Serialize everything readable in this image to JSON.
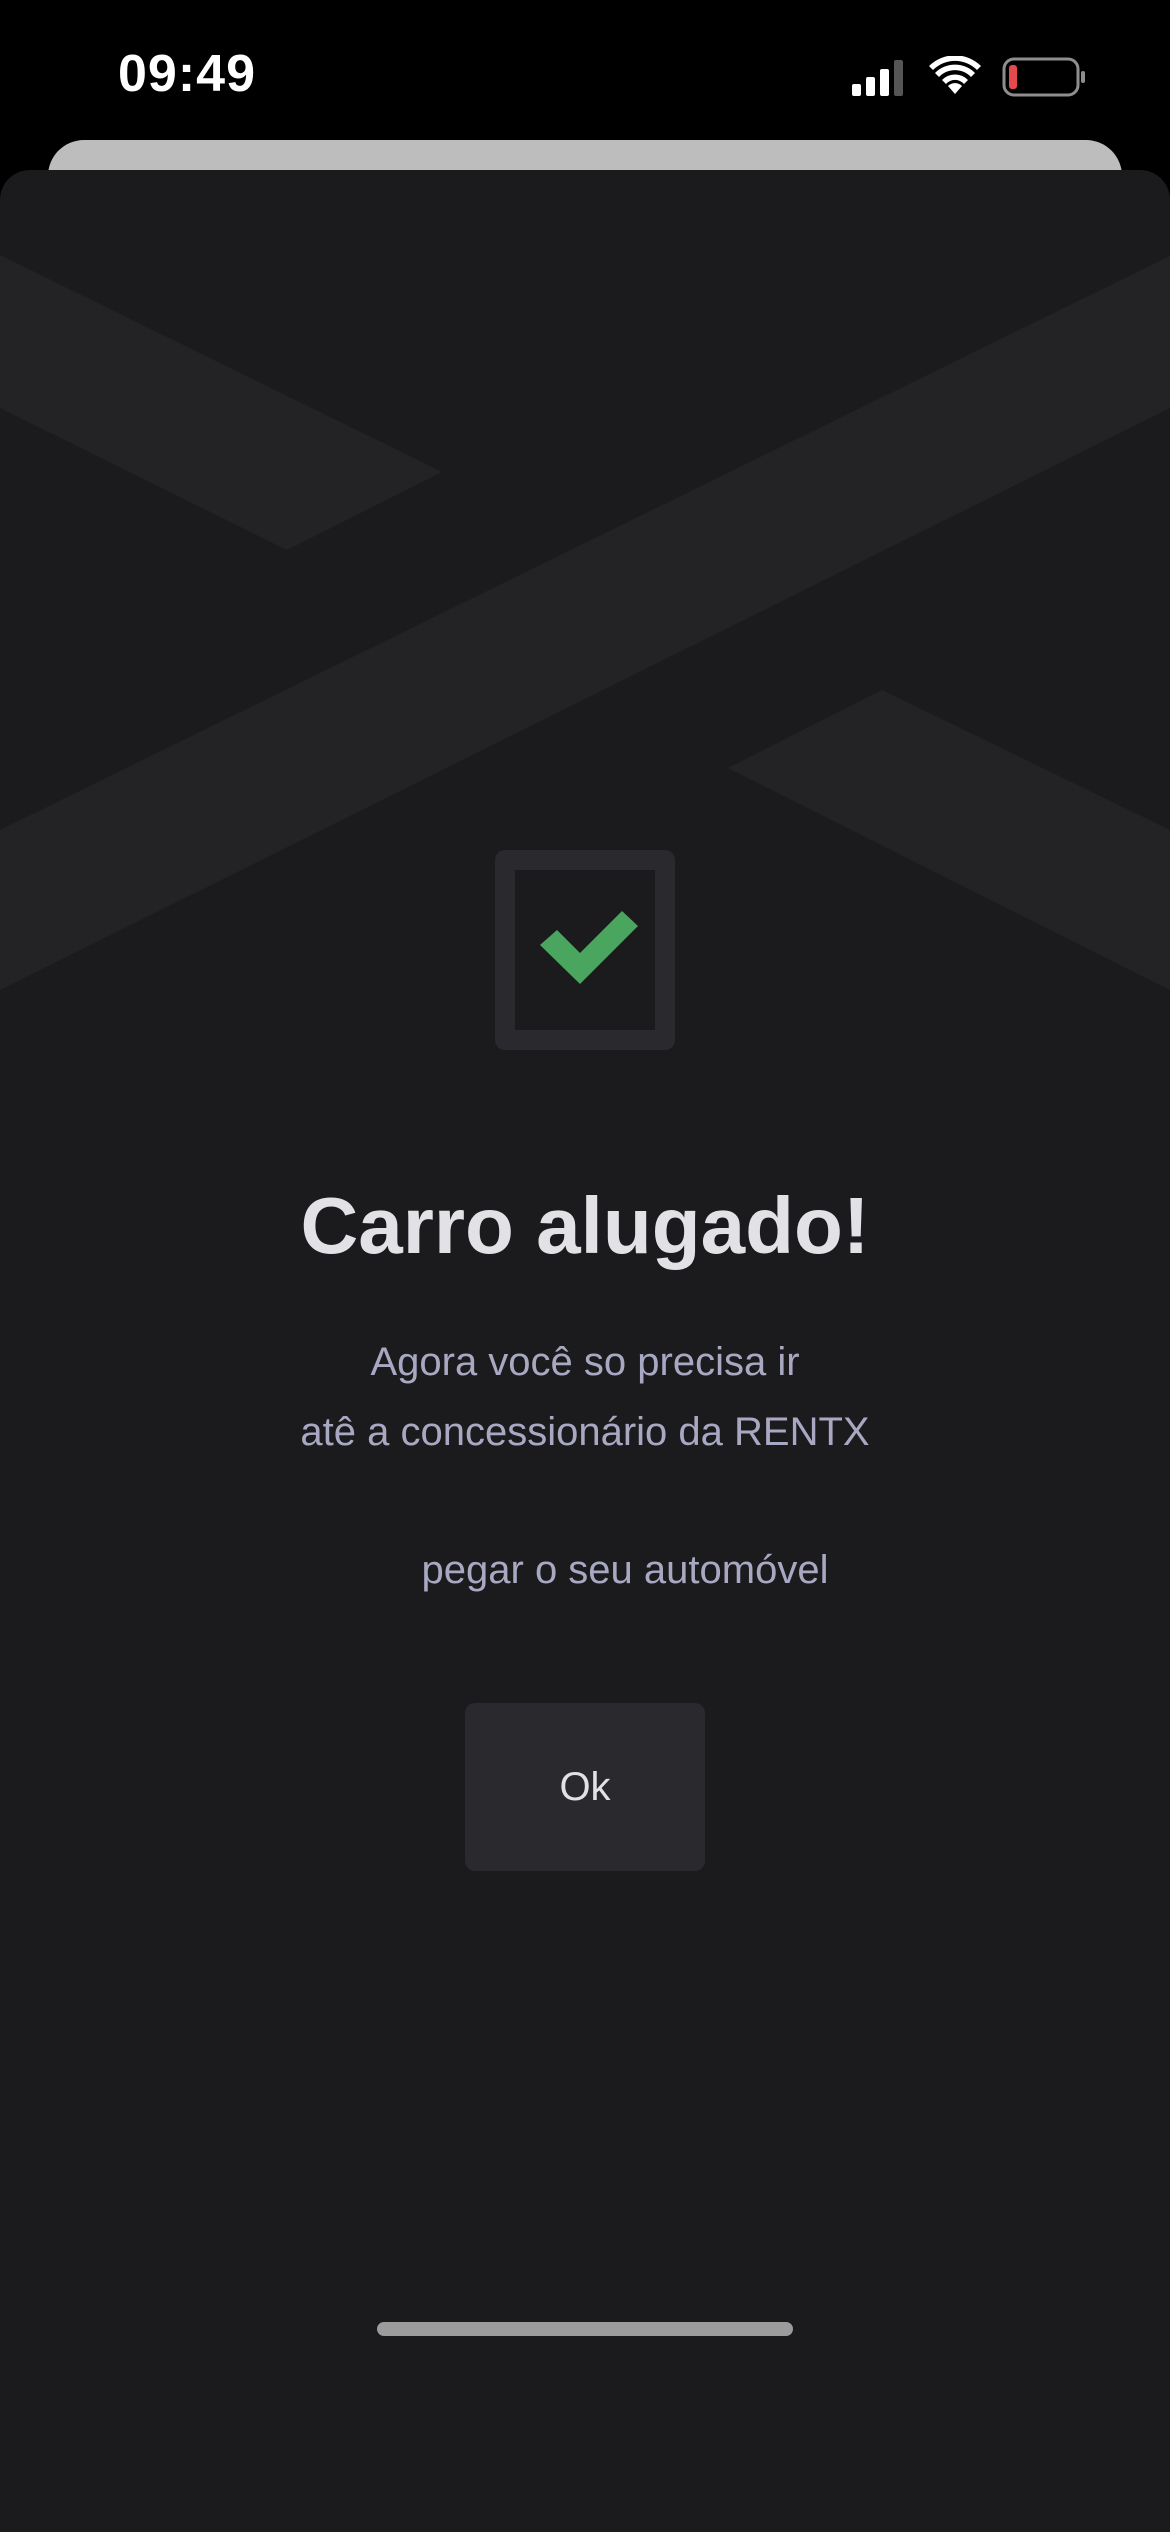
{
  "status_bar": {
    "time": "09:49",
    "icons": [
      "cellular-signal-icon",
      "wifi-icon",
      "battery-low-icon"
    ],
    "battery_color": "#e5484d"
  },
  "confirmation": {
    "icon": "checkmark-icon",
    "check_color": "#4aa55e",
    "title": "Carro alugado!",
    "message_line1": "Agora você so precisa ir",
    "message_line2": "atê a concessionário da RENTX",
    "message_line3": "pegar o seu automóvel",
    "ok_label": "Ok"
  },
  "colors": {
    "sheet_background": "#1b1b1d",
    "logo_shape": "#232325",
    "title_text": "#e1e1e6",
    "body_text": "#a8a8c3",
    "button_background": "#29292e"
  }
}
